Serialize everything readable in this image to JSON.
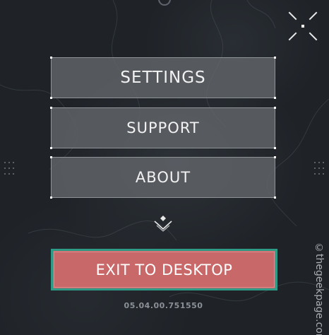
{
  "menu": {
    "settings_label": "SETTINGS",
    "support_label": "SUPPORT",
    "about_label": "ABOUT",
    "more_icon": "chevron-down-icon"
  },
  "exit": {
    "label": "EXIT TO DESKTOP"
  },
  "version": "05.04.00.751550",
  "watermark": "©thegeekpage.com",
  "icons": {
    "fullscreen": "fullscreen-toggle-icon"
  },
  "colors": {
    "background": "#1f2328",
    "menu_button": "#62656a",
    "exit_fill": "#c96869",
    "exit_border": "#2e9b87",
    "version_text": "#8b9097"
  }
}
